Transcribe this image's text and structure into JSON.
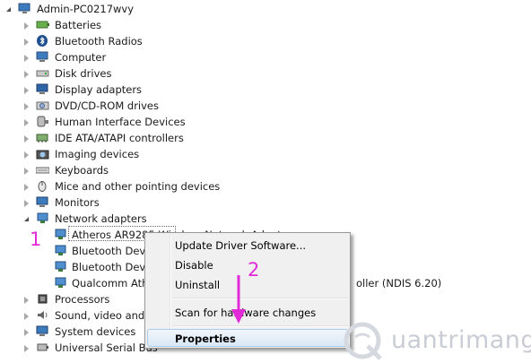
{
  "tree": {
    "root": "Admin-PC0217wvy",
    "categories": [
      {
        "label": "Batteries",
        "icon": "battery-icon"
      },
      {
        "label": "Bluetooth Radios",
        "icon": "bluetooth-icon"
      },
      {
        "label": "Computer",
        "icon": "computer-icon"
      },
      {
        "label": "Disk drives",
        "icon": "disk-drive-icon"
      },
      {
        "label": "Display adapters",
        "icon": "display-adapter-icon"
      },
      {
        "label": "DVD/CD-ROM drives",
        "icon": "dvd-drive-icon"
      },
      {
        "label": "Human Interface Devices",
        "icon": "hid-icon"
      },
      {
        "label": "IDE ATA/ATAPI controllers",
        "icon": "ide-controller-icon"
      },
      {
        "label": "Imaging devices",
        "icon": "camera-icon"
      },
      {
        "label": "Keyboards",
        "icon": "keyboard-icon"
      },
      {
        "label": "Mice and other pointing devices",
        "icon": "mouse-icon"
      },
      {
        "label": "Monitors",
        "icon": "monitor-icon"
      },
      {
        "label": "Network adapters",
        "icon": "network-adapter-icon"
      }
    ],
    "network_children": [
      "Atheros AR9285 Wireless Network Adapter",
      "Bluetooth Devi",
      "Bluetooth Devi",
      "Qualcomm Ath"
    ],
    "qualcomm_suffix": "oller (NDIS 6.20)",
    "after": [
      {
        "label": "Processors",
        "icon": "processor-icon"
      },
      {
        "label": "Sound, video and g",
        "icon": "sound-icon"
      },
      {
        "label": "System devices",
        "icon": "system-devices-icon"
      },
      {
        "label": "Universal Serial Bus",
        "icon": "usb-icon"
      }
    ]
  },
  "context_menu": {
    "update_driver": "Update Driver Software...",
    "disable": "Disable",
    "uninstall": "Uninstall",
    "scan": "Scan for hardware changes",
    "properties": "Properties"
  },
  "annotations": {
    "step1": "1",
    "step2": "2"
  },
  "watermark": "uantrimang",
  "colors": {
    "annotation": "#e22ad8",
    "highlight": "#d9e8f7"
  }
}
